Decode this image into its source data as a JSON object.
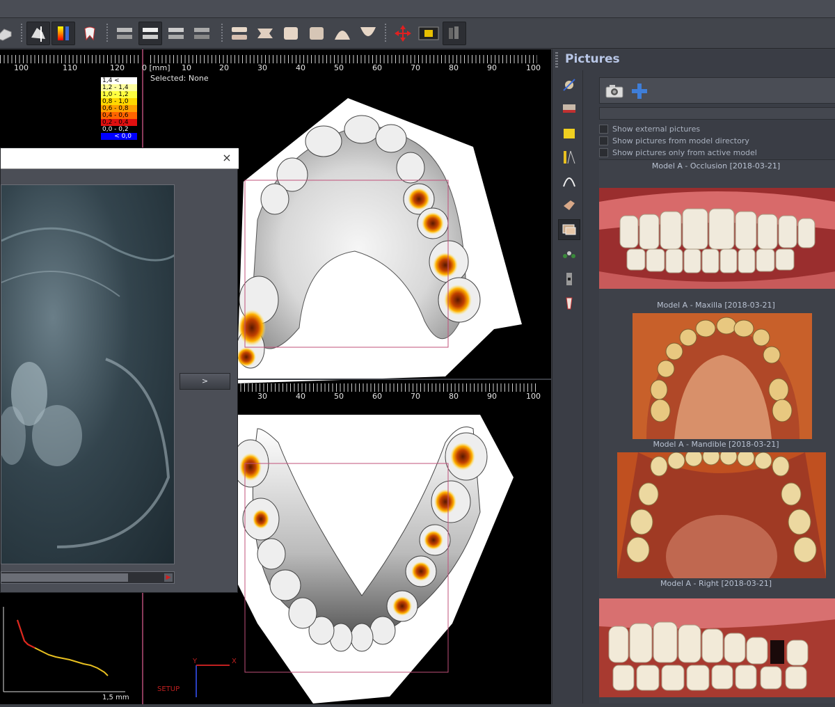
{
  "toolbar": {
    "icons": [
      "model-view-icon",
      "cut-view-icon",
      "color-map-icon",
      "tooth-icon",
      "occlusion-view-1-icon",
      "occlusion-view-2-icon",
      "occlusion-view-3-icon",
      "occlusion-view-4-icon",
      "bite-open-icon",
      "bite-side-icon",
      "bite-front-icon",
      "bite-back-icon",
      "upper-arch-icon",
      "lower-arch-icon",
      "move-icon",
      "align-icon",
      "teeth-group-icon"
    ]
  },
  "viewport": {
    "top_ruler_left_labels": [
      "100",
      "110",
      "120"
    ],
    "top_ruler_right_labels": [
      "0 [mm]",
      "10",
      "20",
      "30",
      "40",
      "50",
      "60",
      "70",
      "80",
      "90",
      "100"
    ],
    "selected_text": "Selected: None",
    "bottom_ruler_labels": [
      "30",
      "40",
      "50",
      "60",
      "70",
      "80",
      "90",
      "100"
    ],
    "legend": [
      {
        "label": "1,4 <",
        "color": "#ffffff"
      },
      {
        "label": "1,2 - 1,4",
        "color": "#ffffa0"
      },
      {
        "label": "1,0 - 1,2",
        "color": "#ffff40"
      },
      {
        "label": "0,8 - 1,0",
        "color": "#ffd800"
      },
      {
        "label": "0,6 - 0,8",
        "color": "#ffa000"
      },
      {
        "label": "0,4 - 0,6",
        "color": "#ff6400"
      },
      {
        "label": "0,2 - 0,4",
        "color": "#e01010"
      },
      {
        "label": "0,0 - 0,2",
        "color": "#000000"
      },
      {
        "label": "< 0,0",
        "color": "#0000ff"
      }
    ],
    "graph_axis_label": "1,5 mm",
    "axis_y": "Y",
    "axis_x": "X",
    "setup_label": "SETUP"
  },
  "dialog": {
    "next_label": ">",
    "close_glyph": "×"
  },
  "panel": {
    "title": "Pictures",
    "camera_icon": "camera-icon",
    "add_icon": "plus-icon",
    "checkboxes": [
      {
        "label": "Show external pictures",
        "checked": false
      },
      {
        "label": "Show pictures from model directory",
        "checked": false
      },
      {
        "label": "Show pictures only from active model",
        "checked": false
      }
    ],
    "captions": [
      "Model A - Occlusion [2018-03-21]",
      "Model A - Maxilla [2018-03-21]",
      "Model A - Mandible [2018-03-21]",
      "Model A - Right [2018-03-21]"
    ],
    "side_icons": [
      "calibrate-icon",
      "ruler-teeth-icon",
      "note-icon",
      "measure-icon",
      "arch-icon",
      "hand-model-icon",
      "pictures-icon",
      "points-icon",
      "tooth-tool-icon",
      "root-icon"
    ]
  }
}
